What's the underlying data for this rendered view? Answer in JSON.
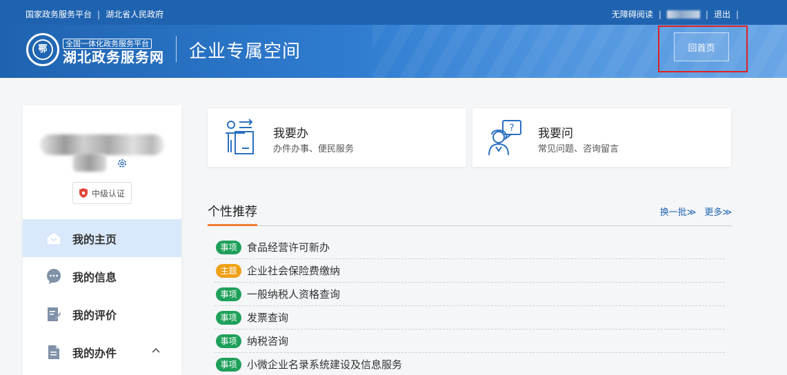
{
  "topbar": {
    "links": [
      "国家政务服务平台",
      "湖北省人民政府"
    ],
    "accessibility": "无障碍阅读",
    "logout": "退出"
  },
  "header": {
    "tag": "全国一体化政务服务平台",
    "site_name": "湖北政务服务网",
    "space_title": "企业专属空间",
    "home_button": "回首页"
  },
  "profile": {
    "cert_level": "中级认证"
  },
  "nav": {
    "items": [
      {
        "label": "我的主页",
        "icon": "home-icon",
        "active": true
      },
      {
        "label": "我的信息",
        "icon": "chat-icon",
        "active": false
      },
      {
        "label": "我的评价",
        "icon": "edit-doc-icon",
        "active": false
      },
      {
        "label": "我的办件",
        "icon": "document-icon",
        "active": false
      }
    ]
  },
  "cards": [
    {
      "title": "我要办",
      "subtitle": "办件办事、便民服务",
      "icon": "service-person-icon"
    },
    {
      "title": "我要问",
      "subtitle": "常见问题、咨询留言",
      "icon": "question-person-icon"
    }
  ],
  "recommend": {
    "title": "个性推荐",
    "refresh": "换一批≫",
    "more": "更多≫",
    "items": [
      {
        "tag": "事项",
        "tag_color": "#1fa05a",
        "text": "食品经营许可新办"
      },
      {
        "tag": "主题",
        "tag_color": "#f0a016",
        "text": "企业社会保险费缴纳"
      },
      {
        "tag": "事项",
        "tag_color": "#1fa05a",
        "text": "一般纳税人资格查询"
      },
      {
        "tag": "事项",
        "tag_color": "#1fa05a",
        "text": "发票查询"
      },
      {
        "tag": "事项",
        "tag_color": "#1fa05a",
        "text": "纳税咨询"
      },
      {
        "tag": "事项",
        "tag_color": "#1fa05a",
        "text": "小微企业名录系统建设及信息服务"
      }
    ]
  }
}
